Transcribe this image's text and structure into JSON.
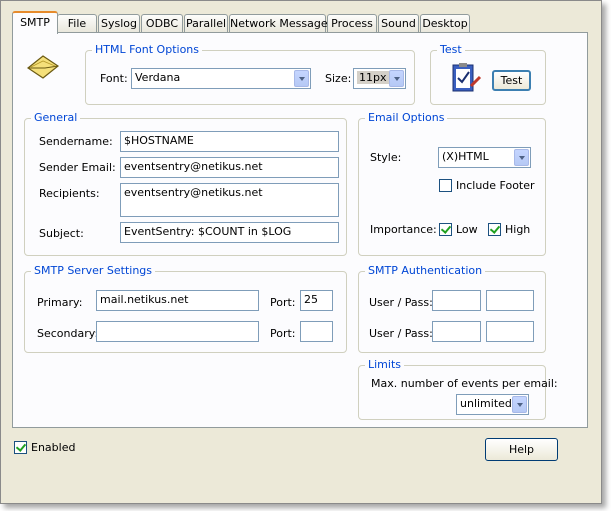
{
  "tabs": [
    "SMTP",
    "File",
    "Syslog",
    "ODBC",
    "Parallel",
    "Network Message",
    "Process",
    "Sound",
    "Desktop"
  ],
  "font_group": {
    "title": "HTML Font Options",
    "font_label": "Font:",
    "font_value": "Verdana",
    "size_label": "Size:",
    "size_value": "11px"
  },
  "test_group": {
    "title": "Test",
    "button": "Test"
  },
  "general": {
    "title": "General",
    "sendername_label": "Sendername:",
    "sendername_value": "$HOSTNAME",
    "sender_email_label": "Sender Email:",
    "sender_email_value": "eventsentry@netikus.net",
    "recipients_label": "Recipients:",
    "recipients_value": "eventsentry@netikus.net",
    "subject_label": "Subject:",
    "subject_value": "EventSentry: $COUNT in $LOG"
  },
  "email_options": {
    "title": "Email Options",
    "style_label": "Style:",
    "style_value": "(X)HTML",
    "include_footer_label": "Include Footer",
    "include_footer_checked": false,
    "importance_label": "Importance:",
    "low_label": "Low",
    "low_checked": true,
    "high_label": "High",
    "high_checked": true
  },
  "smtp_server": {
    "title": "SMTP Server Settings",
    "primary_label": "Primary:",
    "primary_value": "mail.netikus.net",
    "port_label": "Port:",
    "primary_port": "25",
    "secondary_label": "Secondary:",
    "secondary_value": "",
    "secondary_port": ""
  },
  "smtp_auth": {
    "title": "SMTP Authentication",
    "user_pass_label": "User / Pass:"
  },
  "limits": {
    "title": "Limits",
    "max_label": "Max. number of events per email:",
    "max_value": "unlimited"
  },
  "enabled_label": "Enabled",
  "enabled_checked": true,
  "help_button": "Help"
}
